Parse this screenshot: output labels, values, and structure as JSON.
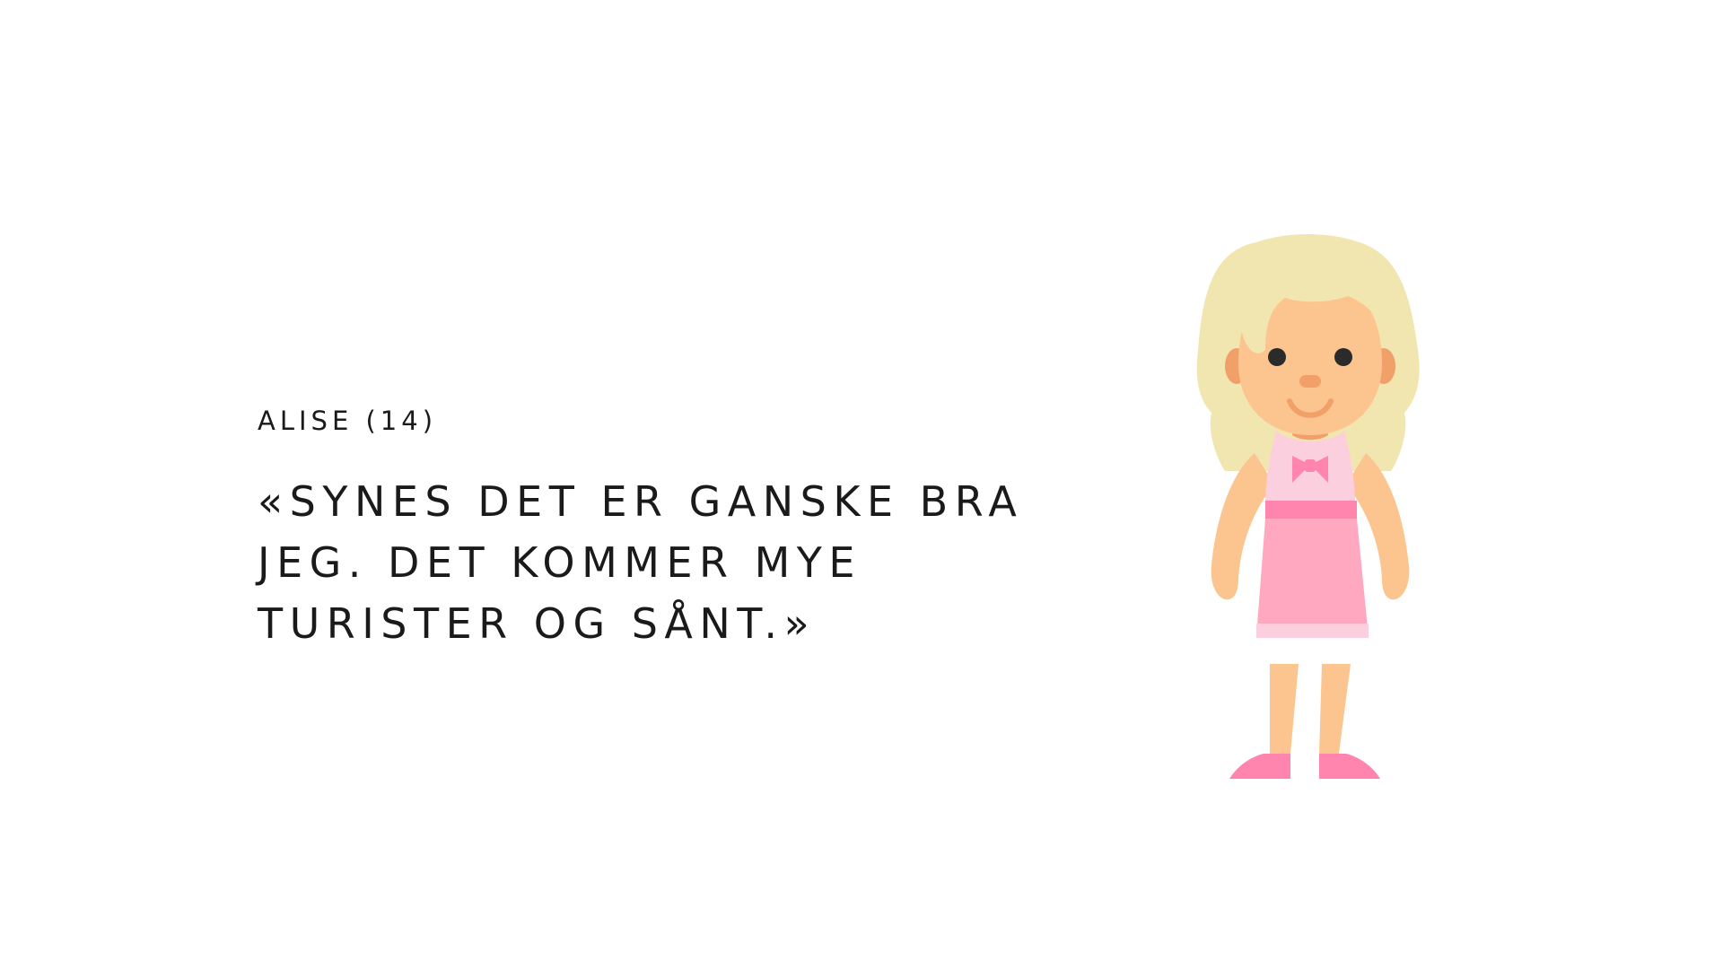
{
  "speaker": {
    "label": "ALISE (14)"
  },
  "quote": {
    "lines": [
      "«SYNES DET ER GANSKE BRA",
      "JEG. DET KOMMER MYE",
      "TURISTER OG SÅNT.»"
    ]
  },
  "illustration": {
    "icon": "girl-character-illustration",
    "colors": {
      "hair": "#F2E6B0",
      "skin": "#FCC48E",
      "ear": "#F2A06A",
      "nose": "#F2A06A",
      "dress_top": "#FCCFDF",
      "dress_skirt": "#FFA8BF",
      "belt": "#FF85AE",
      "bow": "#FF85AE",
      "shoes": "#FF85AE",
      "eyes": "#2B2B2B"
    }
  }
}
